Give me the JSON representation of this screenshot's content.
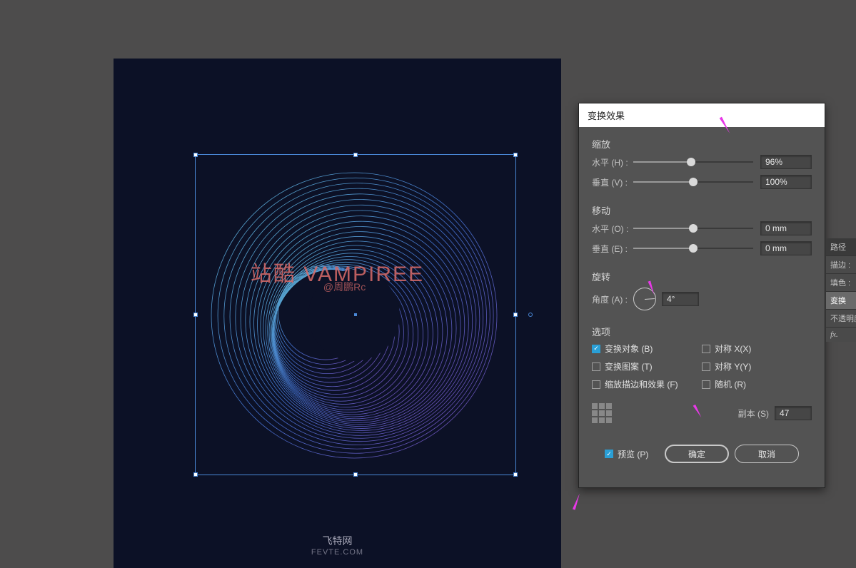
{
  "canvas": {
    "watermark_main": "站酷 VAMPIREE",
    "watermark_sub": "@周鹏Rc",
    "footer_line1": "飞特网",
    "footer_line2": "FEVTE.COM"
  },
  "dialog": {
    "title": "变换效果",
    "scale": {
      "section_label": "缩放",
      "h_label": "水平 (H) :",
      "h_value": "96%",
      "v_label": "垂直 (V) :",
      "v_value": "100%"
    },
    "move": {
      "section_label": "移动",
      "h_label": "水平 (O) :",
      "h_value": "0 mm",
      "v_label": "垂直 (E) :",
      "v_value": "0 mm"
    },
    "rotate": {
      "section_label": "旋转",
      "angle_label": "角度 (A) :",
      "angle_value": "4°"
    },
    "options": {
      "section_label": "选项",
      "transform_object": "变换对象 (B)",
      "transform_pattern": "变换图案 (T)",
      "scale_stroke": "缩放描边和效果 (F)",
      "mirror_x": "对称 X(X)",
      "mirror_y": "对称 Y(Y)",
      "random": "随机 (R)",
      "transform_object_on": true,
      "transform_pattern_on": false,
      "scale_stroke_on": false,
      "mirror_x_on": false,
      "mirror_y_on": false,
      "random_on": false
    },
    "copies": {
      "label": "副本 (S)",
      "value": "47"
    },
    "preview": {
      "label": "预览 (P)",
      "on": true
    },
    "buttons": {
      "ok": "确定",
      "cancel": "取消"
    }
  },
  "side_panel": {
    "title": "路径",
    "stroke": "描边 :",
    "fill": "填色 :",
    "transform": "变换",
    "opacity": "不透明度",
    "fx": "fx."
  }
}
